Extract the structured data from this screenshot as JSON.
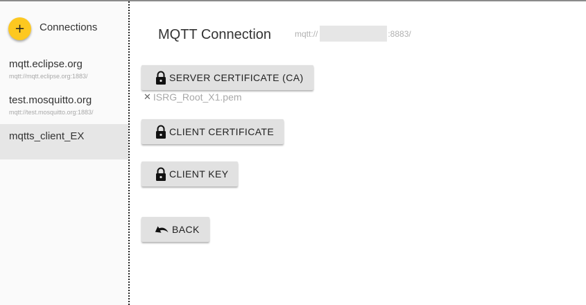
{
  "sidebar": {
    "add_icon": "plus-icon",
    "add_label": "Connections",
    "accent_color": "#fdc820",
    "connections": [
      {
        "name": "mqtt.eclipse.org",
        "url": "mqtt://mqtt.eclipse.org:1883/"
      },
      {
        "name": "test.mosquitto.org",
        "url": "mqtt://test.mosquitto.org:1883/"
      },
      {
        "name": "mqtts_client_EX",
        "url": ""
      }
    ],
    "selected_index": 2
  },
  "main": {
    "title": "MQTT Connection",
    "url_prefix": "mqtt://",
    "url_suffix": ":8883/",
    "buttons": {
      "server_cert": {
        "label": "SERVER CERTIFICATE (CA)",
        "icon": "lock-icon"
      },
      "client_cert": {
        "label": "CLIENT CERTIFICATE",
        "icon": "lock-icon"
      },
      "client_key": {
        "label": "CLIENT KEY",
        "icon": "lock-icon"
      },
      "back": {
        "label": "BACK",
        "icon": "undo-arrow-icon"
      }
    },
    "server_cert_file": {
      "remove_icon": "close-icon",
      "filename": "ISRG_Root_X1.pem"
    }
  }
}
